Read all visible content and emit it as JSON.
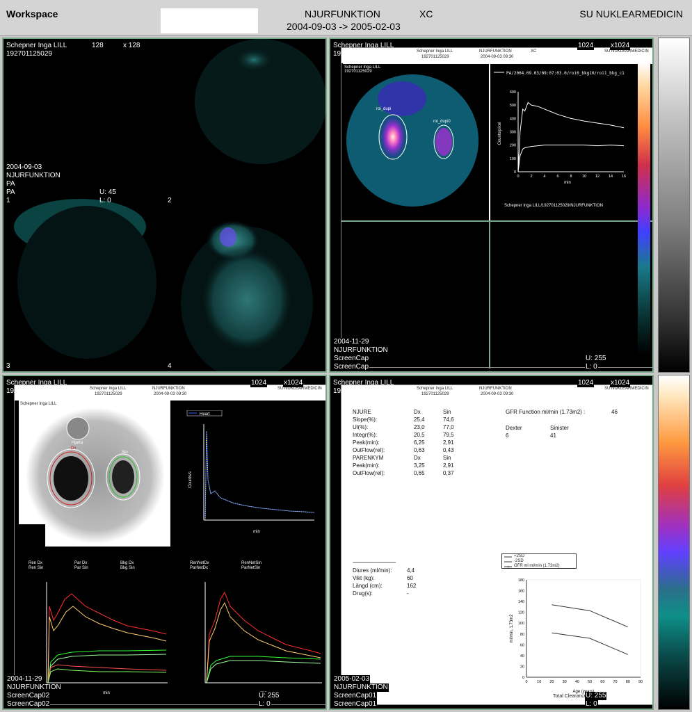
{
  "header": {
    "workspace": "Workspace",
    "study": "NJURFUNKTION",
    "modality": "XC",
    "daterange": "2004-09-03 -> 2005-02-03",
    "institution": "SU NUKLEARMEDICIN"
  },
  "q1": {
    "patient": "Schepner  Inga LILL",
    "pid": "192701125029",
    "matrix_w": "128",
    "matrix_h": "x 128",
    "date": "2004-09-03",
    "study": "NJURFUNKTION",
    "view1": "PA",
    "view2": "PA",
    "upper": "U:   45",
    "lower": "L:    0",
    "frame1": "1",
    "frame2": "2",
    "frame3": "3",
    "frame4": "4"
  },
  "q2": {
    "patient": "Schepner  Inga LILL",
    "pid": "192701125029",
    "matrix_w": "1024",
    "matrix_h": "x1024",
    "date": "2004-11-29",
    "study": "NJURFUNKTION",
    "cap1": "ScreenCap",
    "cap2": "ScreenCap",
    "upper": "U:  255",
    "lower": "L:    0",
    "sheet": {
      "name": "Schepner  Inga LILL",
      "id": "192701125029",
      "study": "NJURFUNKTION",
      "date": "2004-09-03 09:30",
      "modality": "XC",
      "inst": "SU NUKLEARMEDICIN",
      "legend": "PA/2004.09.03/09:07:03.0/roi0_bkg10/roi1_bkg_c1",
      "roi_left": "roi_dupi",
      "roi_right": "roi_dupi0",
      "footer": "Schepner  Inga LILL/192701125029/NJURFUNKTION",
      "yunit": "Counts/pixel",
      "xunit": "min"
    },
    "chart_data": {
      "type": "line",
      "xlabel": "min",
      "ylabel": "Counts/pixel",
      "xlim": [
        0,
        16
      ],
      "ylim": [
        0,
        600
      ],
      "xticks": [
        "0",
        "2",
        "4",
        "6",
        "8",
        "10",
        "12",
        "14",
        "16"
      ],
      "yticks": [
        "0",
        "100",
        "200",
        "300",
        "400",
        "500",
        "600"
      ],
      "series": [
        {
          "x": [
            0,
            0.3,
            0.7,
            1,
            1.5,
            2,
            3,
            4,
            5,
            6,
            8,
            10,
            12,
            14,
            16
          ],
          "values": [
            0,
            300,
            470,
            455,
            520,
            500,
            490,
            470,
            450,
            430,
            400,
            380,
            365,
            350,
            330
          ]
        },
        {
          "x": [
            0,
            0.3,
            0.7,
            1,
            2,
            4,
            6,
            8,
            10,
            12,
            14,
            16
          ],
          "values": [
            0,
            120,
            170,
            180,
            190,
            200,
            200,
            200,
            200,
            195,
            200,
            195
          ]
        }
      ]
    }
  },
  "q3": {
    "patient": "Schepner  Inga LILL",
    "pid": "192701125029",
    "matrix_w": "1024",
    "matrix_h": "x1024",
    "date": "2004-11-29",
    "study": "NJURFUNKTION",
    "cap1": "ScreenCap02",
    "cap2": "ScreenCap02",
    "upper": "U:  255",
    "lower": "L:    0",
    "sheet": {
      "name": "Schepner  Inga LILL",
      "id": "192701125029",
      "study": "NJURFUNKTION",
      "date": "2004-09-03 09:30",
      "inst": "SU NUKLEARMEDICIN",
      "top_legend": "Heart",
      "roi_heart": "Hjarta",
      "roi_dx": "Dx",
      "roi_sin": "Sin",
      "legend_left": [
        "Ren Dx",
        "Ren Sin",
        "Par Dx",
        "Par Sin",
        "Bkg Dx",
        "Bkg Sin"
      ],
      "legend_right": [
        "RenNetDx",
        "RenNetSin",
        "ParNetDx",
        "ParNetSin"
      ],
      "xunit": "min",
      "yunit": "Counts/s"
    }
  },
  "q4": {
    "patient": "Schepner  Inga LILL",
    "pid": "192701125029",
    "matrix_w": "1024",
    "matrix_h": "x1024",
    "date": "2005-02-03",
    "study": "NJURFUNKTION",
    "cap1": "ScreenCap01",
    "cap2": "ScreenCap01",
    "upper": "U:  255",
    "lower": "L:    0",
    "sheet": {
      "name": "Schepner  Inga LILL",
      "id": "192701125029",
      "study": "NJURFUNKTION",
      "date": "2004-09-03 09:30",
      "inst": "SU NUKLEARMEDICIN",
      "rows": [
        {
          "k": "NJURE",
          "dx": "Dx",
          "sin": "Sin"
        },
        {
          "k": "Slope(%):",
          "dx": "25,4",
          "sin": "74,6"
        },
        {
          "k": "Ul(%):",
          "dx": "23,0",
          "sin": "77,0"
        },
        {
          "k": "Integr(%):",
          "dx": "20,5",
          "sin": "79,5"
        },
        {
          "k": "Peak(min):",
          "dx": "6,25",
          "sin": "2,91"
        },
        {
          "k": "OutFlow(rel):",
          "dx": "0,63",
          "sin": "0,43"
        },
        {
          "k": "PARENKYM",
          "dx": "Dx",
          "sin": "Sin"
        },
        {
          "k": "Peak(min):",
          "dx": "3,25",
          "sin": "2,91"
        },
        {
          "k": "OutFlow(rel):",
          "dx": "0,65",
          "sin": "0,37"
        }
      ],
      "gfr_label": "GFR Function ml/min (1.73m2) :",
      "gfr_value": "46",
      "dexter": "Dexter",
      "sinister": "Sinister",
      "dexter_val": "6",
      "sinister_val": "41",
      "divider": "-------------------------------------",
      "extra": [
        {
          "k": "Diures (ml/min):",
          "v": "4,4"
        },
        {
          "k": "Vikt (kg):",
          "v": "60"
        },
        {
          "k": "Längd (cm):",
          "v": "162"
        },
        {
          "k": "Drug(s):",
          "v": "-"
        }
      ],
      "legend": [
        "+2SD",
        "-2SD",
        "GFR ml ml/min (1.73m2)"
      ],
      "xlabel": "Age (years)",
      "ylabel": "ml/min, 1.73m2",
      "footer": "Total Clearance"
    },
    "chart_data": {
      "type": "line",
      "xlabel": "Age (years)",
      "ylabel": "ml/min, 1.73m2",
      "xlim": [
        0,
        90
      ],
      "ylim": [
        0,
        180
      ],
      "xticks": [
        "0",
        "10",
        "20",
        "30",
        "40",
        "50",
        "60",
        "70",
        "80",
        "90"
      ],
      "yticks": [
        "0",
        "20",
        "40",
        "60",
        "80",
        "100",
        "120",
        "140",
        "160",
        "180"
      ],
      "series": [
        {
          "name": "+2SD",
          "x": [
            20,
            50,
            80
          ],
          "values": [
            134,
            123,
            93
          ]
        },
        {
          "name": "-2SD",
          "x": [
            20,
            50,
            80
          ],
          "values": [
            82,
            72,
            42
          ]
        }
      ]
    }
  },
  "colorbars": {
    "gray": "grayscale",
    "color": "nuclear-colormap"
  }
}
